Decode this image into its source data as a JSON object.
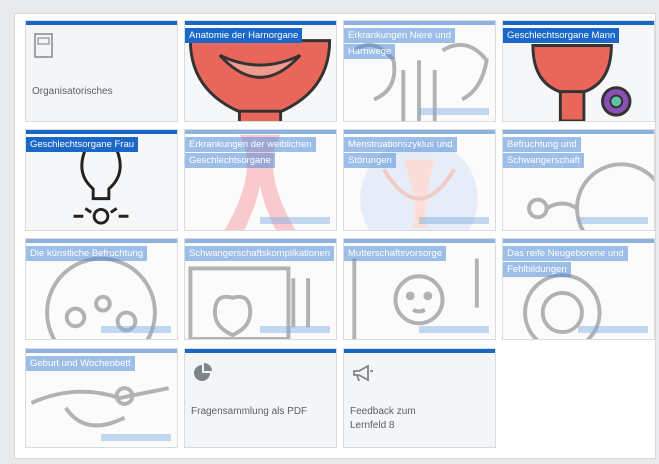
{
  "tiles": [
    {
      "label": "Organisatorisches",
      "icon": "document-icon"
    },
    {
      "label": "Anatomie der Harnorgane",
      "icon": "bladder-icon"
    },
    {
      "label": "Erkrankungen Niere und Harnwege",
      "icon": "kidney-icon"
    },
    {
      "label": "Geschlechtsorgane Mann",
      "icon": "male-organ-icon"
    },
    {
      "label": "Geschlechtsorgane Frau",
      "icon": "uterus-icon"
    },
    {
      "label": "Erkrankungen der weiblichen Geschlechtsorgane",
      "icon": "ribbon-icon"
    },
    {
      "label": "Menstruationszyklus und Störungen",
      "icon": "cycle-icon"
    },
    {
      "label": "Befruchtung und Schwangerschaft",
      "icon": "fertilization-icon"
    },
    {
      "label": "Die künstliche Befruchtung",
      "icon": "petri-dish-icon"
    },
    {
      "label": "Schwangerschaftskomplikationen",
      "icon": "heart-monitor-icon"
    },
    {
      "label": "Mutterschaftsvorsorge",
      "icon": "baby-icon"
    },
    {
      "label": "Das reife Neugeborene und Fehlbildungen",
      "icon": "newborn-icon"
    },
    {
      "label": "Geburt und Wochenbett",
      "icon": "stork-icon"
    },
    {
      "label": "Fragensammlung als PDF",
      "icon": "pie-chart-icon"
    },
    {
      "label": "Feedback zum Lernfeld 8",
      "icon": "megaphone-icon"
    }
  ],
  "colors": {
    "accent": "#1a66c4",
    "label_bg": "#1c68c8",
    "bladder": "#e8675a",
    "text": "#5a6169"
  }
}
